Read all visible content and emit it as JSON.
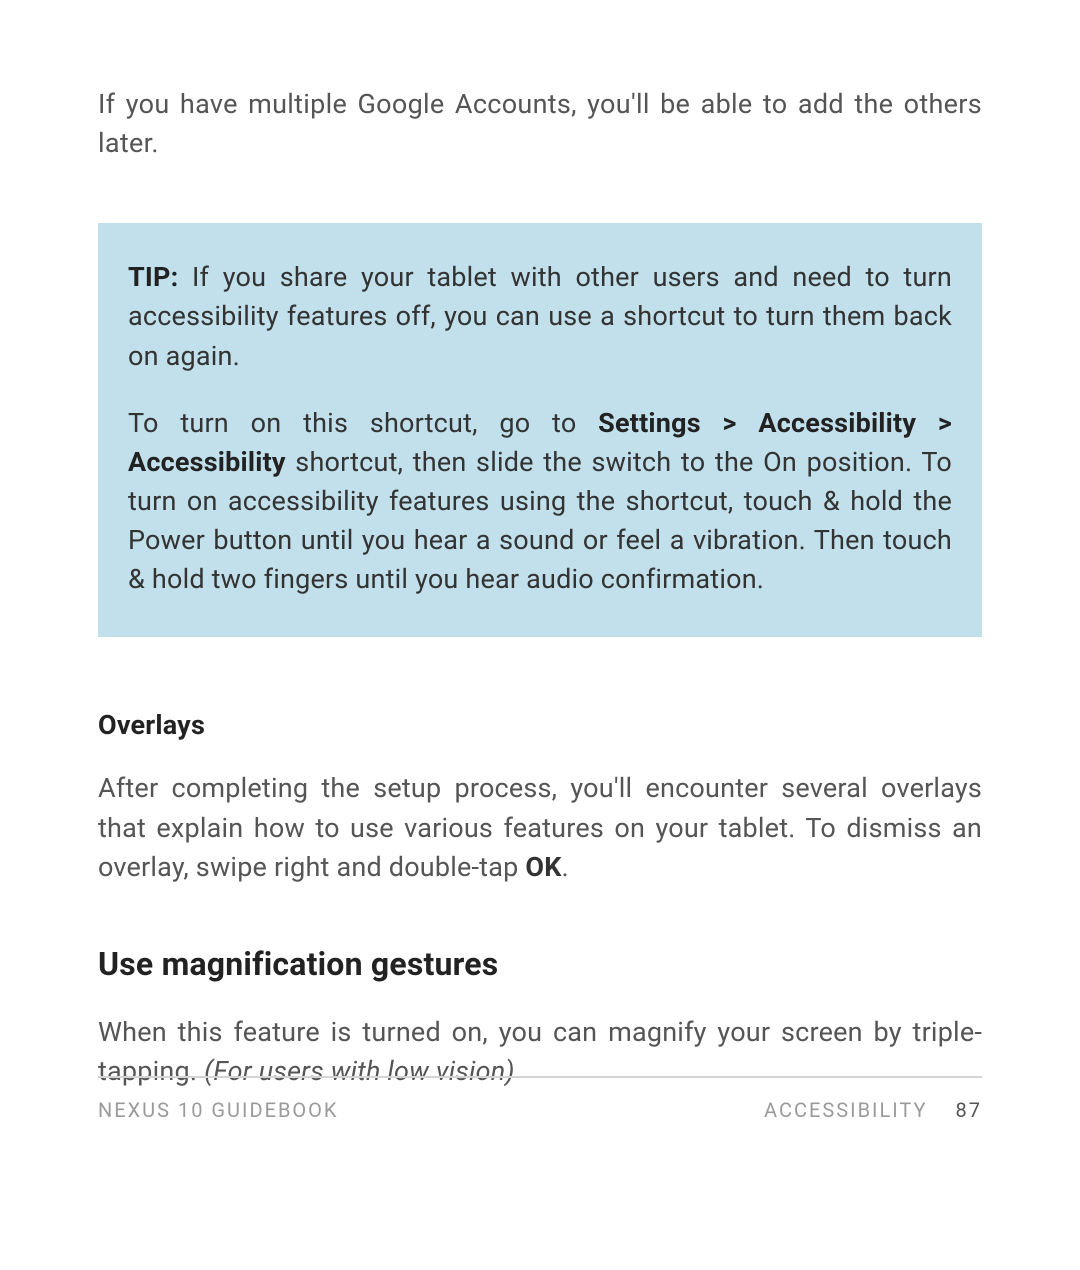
{
  "intro": "If you have multiple Google Accounts, you'll be able to add the others later.",
  "tip": {
    "label": "TIP:",
    "para1_text": " If you share your tablet with other users and need to turn accessibility features off, you can use a shortcut to turn them back on again.",
    "para2_pre": "To turn on this shortcut, go to ",
    "para2_bold": "Settings > Accessibility > Accessibility",
    "para2_post": " shortcut, then slide the switch to the On position. To turn on accessibility features using the shortcut, touch & hold the Power button until you hear a sound or feel a vibration. Then touch & hold two fingers until you hear audio confirmation."
  },
  "overlays": {
    "heading": "Overlays",
    "text_pre": "After completing the setup process, you'll encounter several overlays that explain how to use various features on your tablet. To dismiss an overlay, swipe right and double-tap ",
    "text_bold": "OK",
    "text_post": "."
  },
  "magnification": {
    "heading": "Use magnification gestures",
    "text_pre": "When this feature is turned on, you can magnify your screen by triple-tapping. ",
    "text_italic": "(For users with low vision)"
  },
  "footer": {
    "left": "NEXUS 10 GUIDEBOOK",
    "right": "ACCESSIBILITY",
    "page": "87"
  }
}
